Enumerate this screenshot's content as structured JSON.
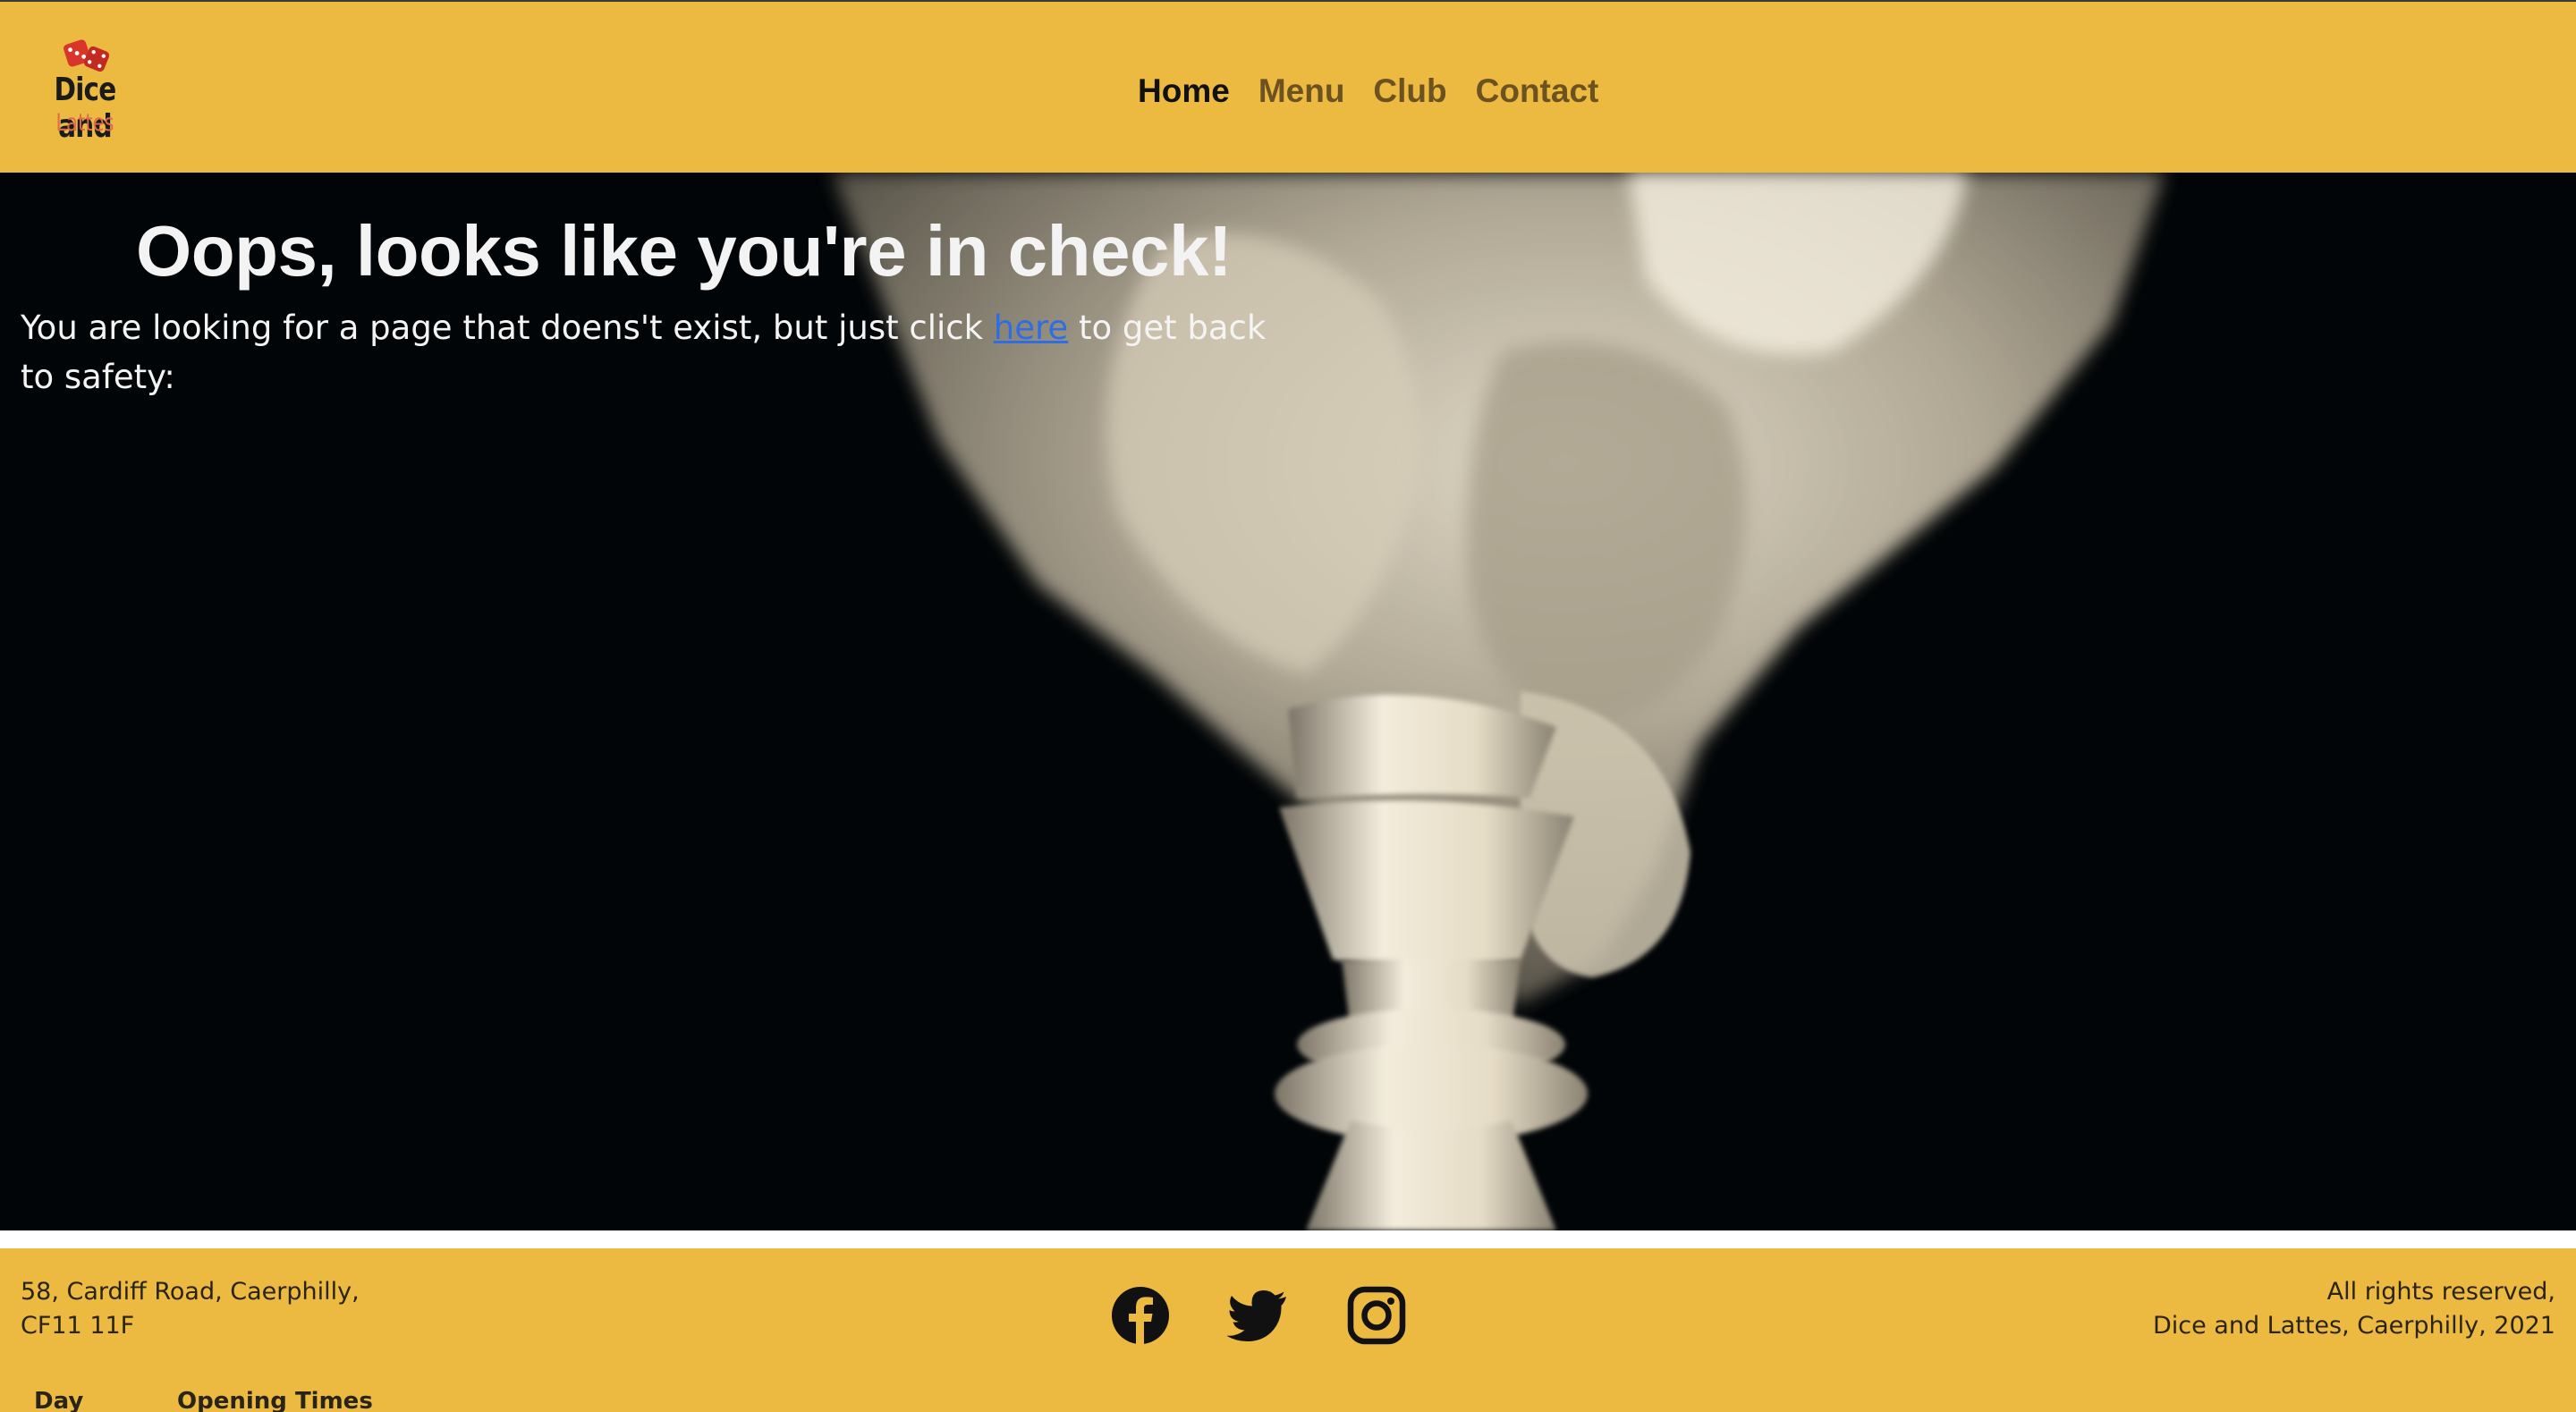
{
  "brand": {
    "name_line1": "Dice and",
    "name_line2": "Lattes",
    "icon": "dice-icon",
    "colors": {
      "primary": "#ecba40",
      "accent": "#e2694a",
      "dice": "#d9362b"
    }
  },
  "nav": {
    "items": [
      {
        "label": "Home",
        "active": true
      },
      {
        "label": "Menu",
        "active": false
      },
      {
        "label": "Club",
        "active": false
      },
      {
        "label": "Contact",
        "active": false
      }
    ]
  },
  "hero": {
    "title": "Oops, looks like you're in check!",
    "text_before": "You are looking for a page that doens't exist, but just click ",
    "link_label": "here",
    "text_after": " to get back to safety:",
    "background": "chess-king-piece-photo",
    "link_color": "#2f6de0"
  },
  "footer": {
    "address": "58, Cardiff Road, Caerphilly, CF11 11F",
    "social": [
      {
        "name": "facebook-icon"
      },
      {
        "name": "twitter-icon"
      },
      {
        "name": "instagram-icon"
      }
    ],
    "rights_line1": "All rights reserved,",
    "rights_line2": "Dice and Lattes, Caerphilly, 2021",
    "hours_headers": {
      "day": "Day",
      "times": "Opening Times"
    }
  }
}
